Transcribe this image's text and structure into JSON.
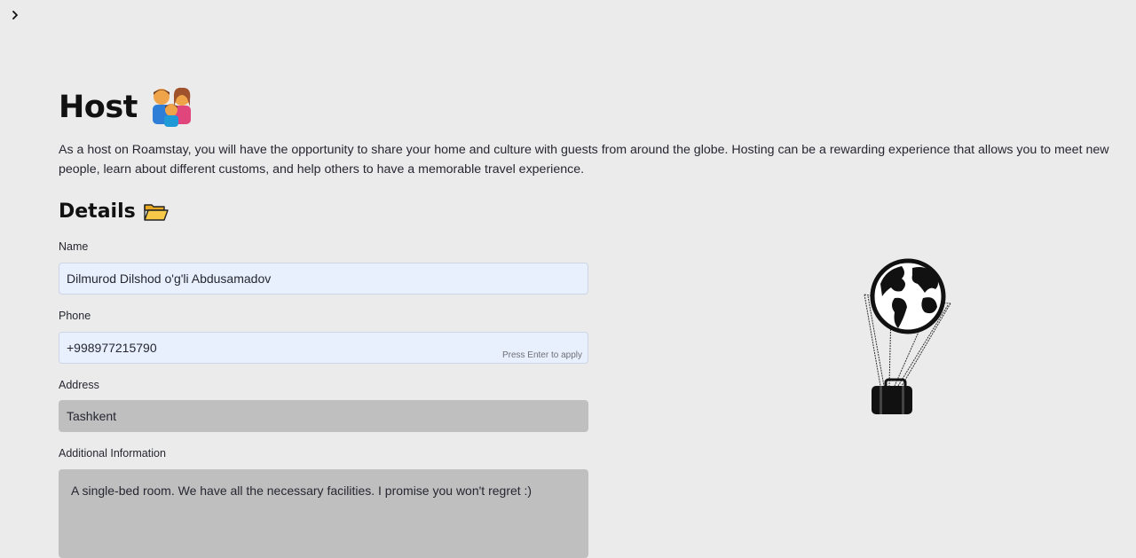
{
  "sidebar": {
    "toggle_icon": "chevron-right-icon"
  },
  "header": {
    "title": "Host",
    "title_icon": "family-emoji-icon"
  },
  "intro": {
    "text": "As a host on Roamstay, you will have the opportunity to share your home and culture with guests from around the globe. Hosting can be a rewarding experience that allows you to meet new people, learn about different customs, and help others to have a memorable travel experience."
  },
  "details": {
    "title": "Details",
    "title_icon": "open-folder-icon"
  },
  "form": {
    "name": {
      "label": "Name",
      "value": "Dilmurod Dilshod o'g'li Abdusamadov"
    },
    "phone": {
      "label": "Phone",
      "value": "+998977215790",
      "hint": "Press Enter to apply"
    },
    "address": {
      "label": "Address",
      "value": "Tashkent"
    },
    "additional": {
      "label": "Additional Information",
      "value": "A single-bed room. We have all the necessary facilities. I promise you won't regret :)"
    }
  },
  "illustration": {
    "icon": "globe-parachute-suitcase-icon"
  }
}
